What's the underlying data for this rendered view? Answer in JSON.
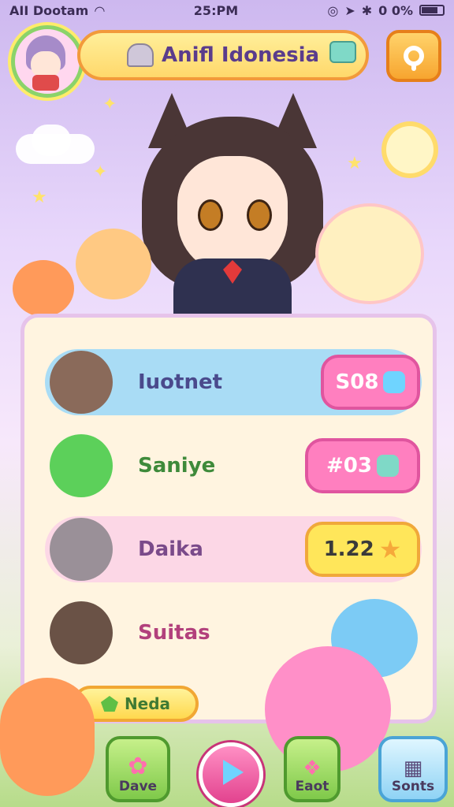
{
  "status_bar": {
    "carrier": "AII Dootam",
    "time": "25:PM",
    "battery": "0 0%"
  },
  "header": {
    "title": "Anifl Idonesia"
  },
  "leaderboard": [
    {
      "name": "Iuotnet",
      "score": "S08",
      "name_color": "#4a4a8c",
      "row_color": "#a9dcf5",
      "btn_color": "#ff7fbf",
      "btn_border": "#e0559f",
      "icon": "music-note-icon"
    },
    {
      "name": "Saniye",
      "score": "#03",
      "name_color": "#3e8a3a",
      "row_color": "#fff4e0",
      "btn_color": "#ff7fbf",
      "btn_border": "#e0559f",
      "icon": "cup-icon"
    },
    {
      "name": "Daika",
      "score": "1.22",
      "name_color": "#7a4a8a",
      "row_color": "#fcd7e6",
      "btn_color": "#ffe65a",
      "btn_border": "#f0a83a",
      "icon": "star-icon"
    },
    {
      "name": "Suitas",
      "score": "",
      "name_color": "#b2407c",
      "row_color": "#fff4e0",
      "btn_color": "",
      "btn_border": "",
      "icon": ""
    }
  ],
  "next_button": {
    "label": "Neda"
  },
  "bottom_nav": {
    "left": "Dave",
    "middle": "Eaot",
    "right": "Sonts"
  }
}
